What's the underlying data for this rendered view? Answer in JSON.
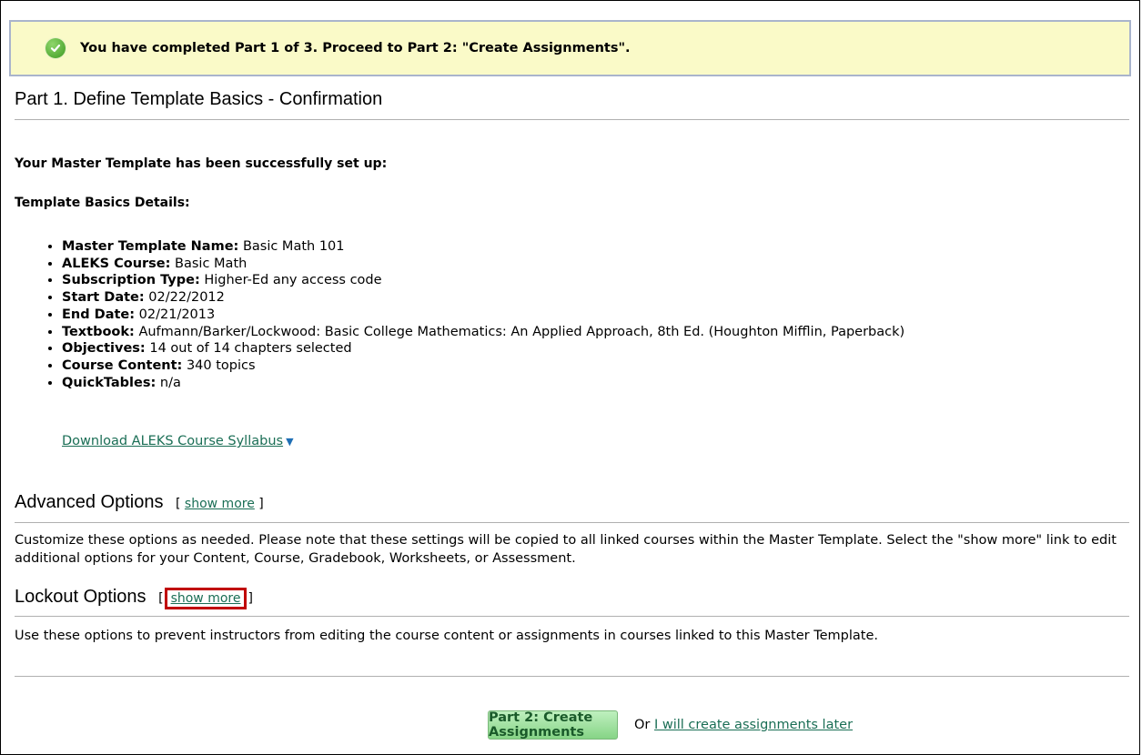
{
  "banner": {
    "icon": "check-circle-icon",
    "text": "You have completed Part 1 of 3. Proceed to Part 2: \"Create Assignments\"."
  },
  "page_title": "Part 1. Define Template Basics - Confirmation",
  "success_message": "Your Master Template has been successfully set up:",
  "details_heading": "Template Basics Details:",
  "details": [
    {
      "label": "Master Template Name:",
      "value": "Basic Math 101"
    },
    {
      "label": "ALEKS Course:",
      "value": "Basic Math"
    },
    {
      "label": "Subscription Type:",
      "value": "Higher-Ed any access code"
    },
    {
      "label": "Start Date:",
      "value": "02/22/2012"
    },
    {
      "label": "End Date:",
      "value": "02/21/2013"
    },
    {
      "label": "Textbook:",
      "value": "Aufmann/Barker/Lockwood: Basic College Mathematics: An Applied Approach, 8th Ed. (Houghton Mifflin, Paperback)"
    },
    {
      "label": "Objectives:",
      "value": "14 out of 14 chapters selected"
    },
    {
      "label": "Course Content:",
      "value": "340 topics"
    },
    {
      "label": "QuickTables:",
      "value": "n/a"
    }
  ],
  "download_link": "Download ALEKS Course Syllabus",
  "advanced": {
    "title": "Advanced Options",
    "show_more": "show more",
    "description": "Customize these options as needed. Please note that these settings will be copied to all linked courses within the Master Template. Select the \"show more\" link to edit additional options for your Content, Course, Gradebook, Worksheets, or Assessment."
  },
  "lockout": {
    "title": "Lockout Options",
    "show_more": "show more",
    "description": "Use these options to prevent instructors from editing the course content or assignments in courses linked to this Master Template."
  },
  "footer": {
    "button_label": "Part 2: Create Assignments",
    "or_text": "Or",
    "later_link": "I will create assignments later"
  },
  "colors": {
    "banner_bg": "#fafac8",
    "link": "#1a6e55",
    "highlight_border": "#c00000",
    "button_green": "#86d486"
  }
}
